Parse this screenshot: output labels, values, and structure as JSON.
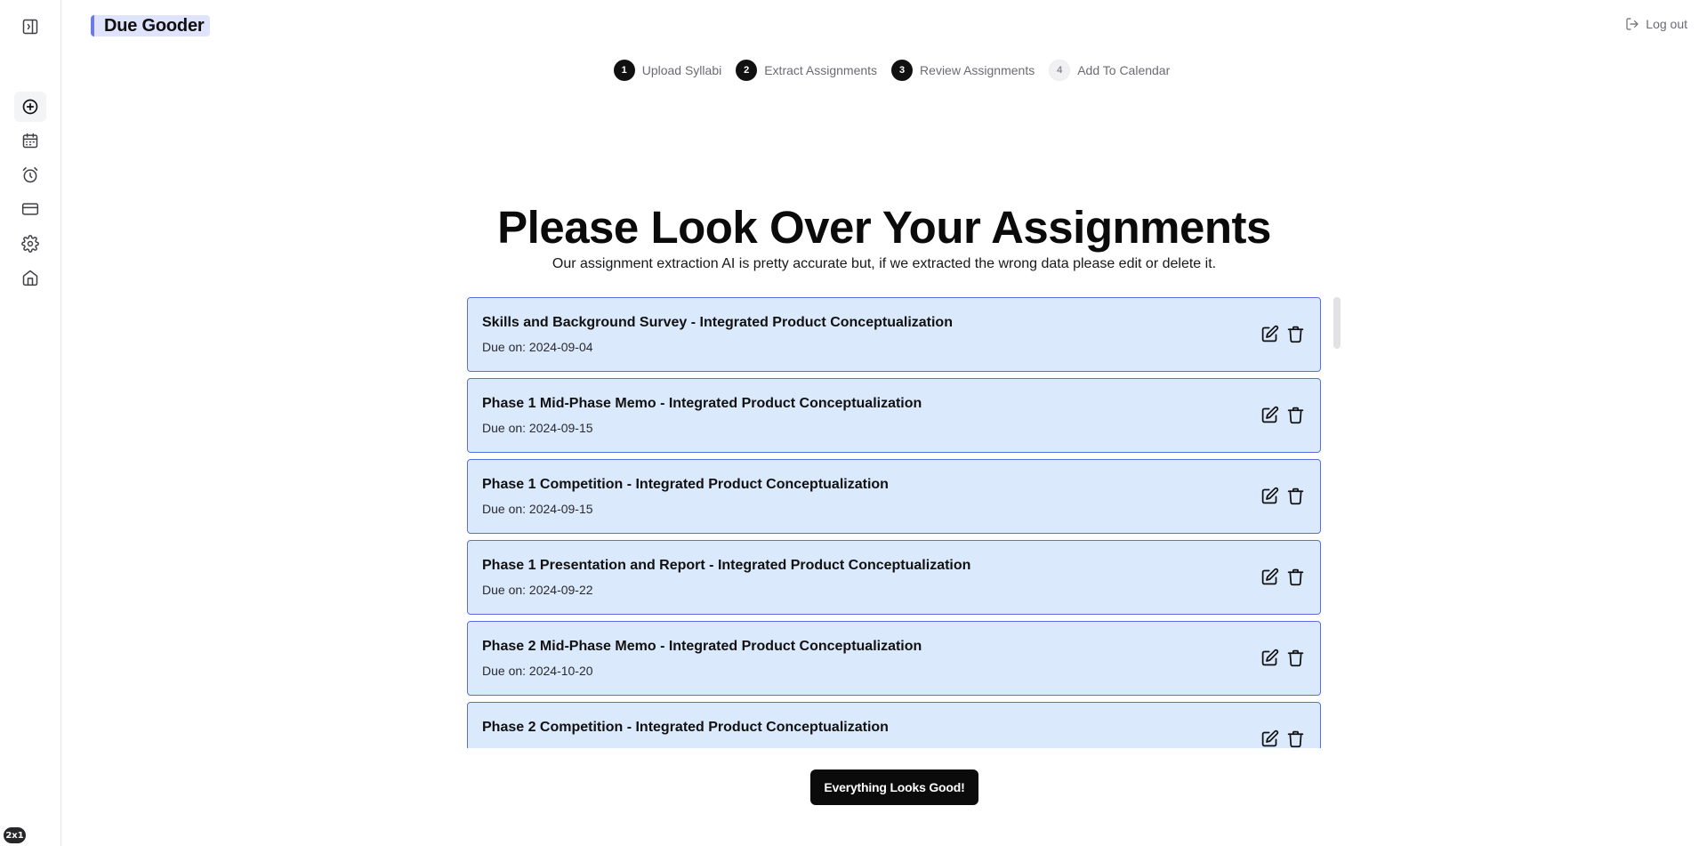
{
  "app": {
    "name": "Due Gooder",
    "logout_label": "Log out",
    "badge": "2x1"
  },
  "sidebar": {
    "items": [
      {
        "icon": "panel-toggle-icon",
        "name": "sidebar-toggle"
      },
      {
        "icon": "plus-circle-icon",
        "name": "add"
      },
      {
        "icon": "calendar-icon",
        "name": "calendar"
      },
      {
        "icon": "alarm-clock-icon",
        "name": "reminders"
      },
      {
        "icon": "credit-card-icon",
        "name": "billing"
      },
      {
        "icon": "gear-icon",
        "name": "settings"
      },
      {
        "icon": "home-icon",
        "name": "home"
      }
    ],
    "active": "add"
  },
  "stepper": {
    "steps": [
      {
        "num": "1",
        "label": "Upload Syllabi",
        "status": "done"
      },
      {
        "num": "2",
        "label": "Extract Assignments",
        "status": "done"
      },
      {
        "num": "3",
        "label": "Review Assignments",
        "status": "current"
      },
      {
        "num": "4",
        "label": "Add To Calendar",
        "status": "pending"
      }
    ]
  },
  "main": {
    "title": "Please Look Over Your Assignments",
    "subtitle": "Our assignment extraction AI is pretty accurate but, if we extracted the wrong data please edit or delete it.",
    "assignments": [
      {
        "title": "Skills and Background Survey - Integrated Product Conceptualization",
        "due": "Due on: 2024-09-04"
      },
      {
        "title": "Phase 1 Mid-Phase Memo - Integrated Product Conceptualization",
        "due": "Due on: 2024-09-15"
      },
      {
        "title": "Phase 1 Competition - Integrated Product Conceptualization",
        "due": "Due on: 2024-09-15"
      },
      {
        "title": "Phase 1 Presentation and Report - Integrated Product Conceptualization",
        "due": "Due on: 2024-09-22"
      },
      {
        "title": "Phase 2 Mid-Phase Memo - Integrated Product Conceptualization",
        "due": "Due on: 2024-10-20"
      },
      {
        "title": "Phase 2 Competition - Integrated Product Conceptualization",
        "due": ""
      }
    ],
    "confirm_label": "Everything Looks Good!"
  },
  "colors": {
    "card_bg": "#dbe9fc",
    "card_border": "#5b6ee0",
    "logo_bg": "#dfe3fb",
    "logo_accent": "#6b7ae8"
  }
}
